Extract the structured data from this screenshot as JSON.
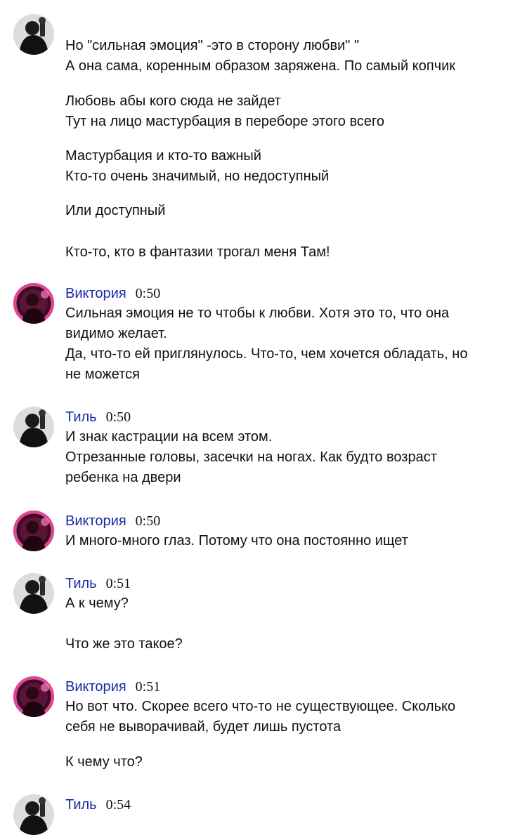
{
  "messages": [
    {
      "author": "",
      "time": "",
      "avatar": "til-avatar",
      "lines": [
        "Но \"сильная эмоция\" -это в сторону любви\" \"",
        "А она сама, коренным образом заряжена. По самый копчик",
        "Любовь абы кого сюда не зайдет",
        "Тут на лицо мастурбация в переборе этого всего",
        "Мастурбация и кто-то важный",
        "Кто-то очень значимый, но недоступный",
        "Или доступный",
        "Кто-то, кто в фантазии трогал меня Там!"
      ]
    },
    {
      "author": "Виктория",
      "time": "0:50",
      "avatar": "viktoriya-avatar",
      "lines": [
        "Сильная эмоция не то чтобы к любви. Хотя это то, что она",
        "видимо желает.",
        "Да, что-то ей приглянулось. Что-то, чем хочется обладать, но",
        "не можется"
      ]
    },
    {
      "author": "Тиль",
      "time": "0:50",
      "avatar": "til-avatar",
      "lines": [
        "И знак кастрации на всем этом.",
        "Отрезанные головы, засечки на ногах. Как будто возраст",
        "ребенка на двери"
      ]
    },
    {
      "author": "Виктория",
      "time": "0:50",
      "avatar": "viktoriya-avatar",
      "lines": [
        "И много-много глаз. Потому что она постоянно ищет"
      ]
    },
    {
      "author": "Тиль",
      "time": "0:51",
      "avatar": "til-avatar",
      "lines": [
        "А к чему?",
        "Что же это такое?"
      ]
    },
    {
      "author": "Виктория",
      "time": "0:51",
      "avatar": "viktoriya-avatar",
      "lines": [
        "Но вот что. Скорее всего что-то не существующее. Сколько",
        "себя не выворачивай, будет лишь пустота",
        "К чему что?"
      ]
    },
    {
      "author": "Тиль",
      "time": "0:54",
      "avatar": "til-avatar",
      "lines": []
    }
  ]
}
